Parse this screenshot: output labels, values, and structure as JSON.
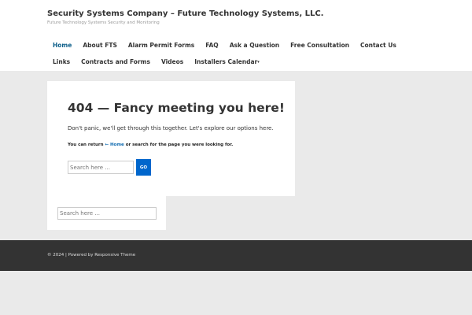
{
  "header": {
    "title": "Security Systems Company – Future Technology Systems, LLC.",
    "tagline": "Future Technology Systems Security and Monitoring"
  },
  "nav": {
    "items": [
      "Home",
      "About FTS",
      "Alarm Permit Forms",
      "FAQ",
      "Ask a Question",
      "Free Consultation",
      "Contact Us",
      "Links",
      "Contracts and Forms",
      "Videos",
      "Installers Calendar"
    ],
    "caret": "▾"
  },
  "main": {
    "heading": "404 — Fancy meeting you here!",
    "text": "Don't panic, we'll get through this together. Let's explore our options here.",
    "return_prefix": "You can return ",
    "return_link": "← Home",
    "return_suffix": " or search for the page you were looking for.",
    "search_placeholder": "Search here ...",
    "go_label": "GO"
  },
  "sidebar": {
    "search_placeholder": "Search here ..."
  },
  "footer": {
    "copyright": "© 2024 | Powered by Responsive Theme"
  },
  "colors": {
    "accent": "#0066cc",
    "link": "#0e6ab0",
    "footer_bg": "#333333"
  }
}
